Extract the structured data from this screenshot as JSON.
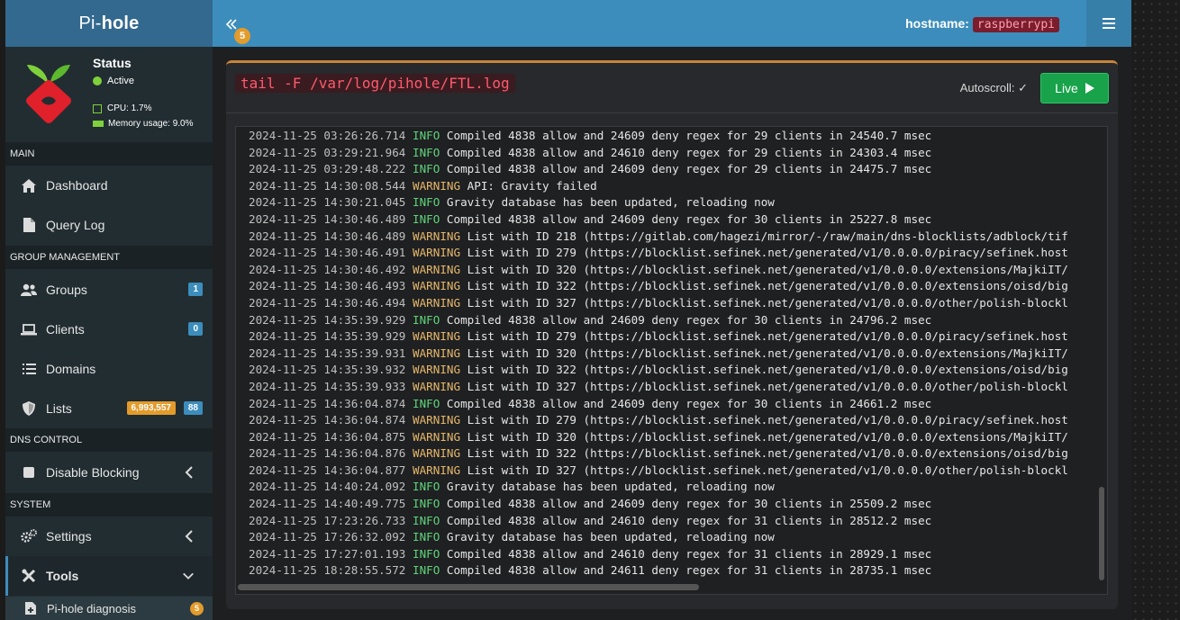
{
  "header": {
    "logo_light": "Pi-",
    "logo_bold": "hole",
    "collapse_badge": "5",
    "hostname_label": "hostname:",
    "hostname_value": "raspberrypi"
  },
  "sidebar": {
    "status_title": "Status",
    "status_text": "Active",
    "cpu_text": "CPU: 1.7%",
    "memory_text": "Memory usage: 9.0%",
    "sections": {
      "main": "MAIN",
      "group_management": "GROUP MANAGEMENT",
      "dns_control": "DNS CONTROL",
      "system": "SYSTEM"
    },
    "items": {
      "dashboard": "Dashboard",
      "query_log": "Query Log",
      "groups": "Groups",
      "groups_badge": "1",
      "clients": "Clients",
      "clients_badge": "0",
      "domains": "Domains",
      "lists": "Lists",
      "lists_badge_domains": "6,993,557",
      "lists_badge_count": "88",
      "disable_blocking": "Disable Blocking",
      "settings": "Settings",
      "tools": "Tools",
      "pihole_diagnosis": "Pi-hole diagnosis",
      "pihole_diagnosis_badge": "5"
    }
  },
  "main": {
    "command": "tail -F /var/log/pihole/FTL.log",
    "autoscroll_label": "Autoscroll:",
    "autoscroll_check": "✓",
    "live_label": "Live",
    "colors": {
      "info": "#5fd47a",
      "warning": "#e5b76a",
      "accent": "#3c8dbc",
      "box_border": "#c7843a"
    },
    "log": [
      {
        "ts": "2024-11-25 03:26:26.714",
        "level": "INFO",
        "msg": "Compiled 4838 allow and 24609 deny regex for 29 clients in 24540.7 msec"
      },
      {
        "ts": "2024-11-25 03:29:21.964",
        "level": "INFO",
        "msg": "Compiled 4838 allow and 24610 deny regex for 29 clients in 24303.4 msec"
      },
      {
        "ts": "2024-11-25 03:29:48.222",
        "level": "INFO",
        "msg": "Compiled 4838 allow and 24609 deny regex for 29 clients in 24475.7 msec"
      },
      {
        "ts": "2024-11-25 14:30:08.544",
        "level": "WARNING",
        "msg": "API: Gravity failed"
      },
      {
        "ts": "2024-11-25 14:30:21.045",
        "level": "INFO",
        "msg": "Gravity database has been updated, reloading now"
      },
      {
        "ts": "2024-11-25 14:30:46.489",
        "level": "INFO",
        "msg": "Compiled 4838 allow and 24609 deny regex for 30 clients in 25227.8 msec"
      },
      {
        "ts": "2024-11-25 14:30:46.489",
        "level": "WARNING",
        "msg": "List with ID 218 (https://gitlab.com/hagezi/mirror/-/raw/main/dns-blocklists/adblock/tif"
      },
      {
        "ts": "2024-11-25 14:30:46.491",
        "level": "WARNING",
        "msg": "List with ID 279 (https://blocklist.sefinek.net/generated/v1/0.0.0.0/piracy/sefinek.host"
      },
      {
        "ts": "2024-11-25 14:30:46.492",
        "level": "WARNING",
        "msg": "List with ID 320 (https://blocklist.sefinek.net/generated/v1/0.0.0.0/extensions/MajkiIT/"
      },
      {
        "ts": "2024-11-25 14:30:46.493",
        "level": "WARNING",
        "msg": "List with ID 322 (https://blocklist.sefinek.net/generated/v1/0.0.0.0/extensions/oisd/big"
      },
      {
        "ts": "2024-11-25 14:30:46.494",
        "level": "WARNING",
        "msg": "List with ID 327 (https://blocklist.sefinek.net/generated/v1/0.0.0.0/other/polish-blockl"
      },
      {
        "ts": "2024-11-25 14:35:39.929",
        "level": "INFO",
        "msg": "Compiled 4838 allow and 24609 deny regex for 30 clients in 24796.2 msec"
      },
      {
        "ts": "2024-11-25 14:35:39.929",
        "level": "WARNING",
        "msg": "List with ID 279 (https://blocklist.sefinek.net/generated/v1/0.0.0.0/piracy/sefinek.host"
      },
      {
        "ts": "2024-11-25 14:35:39.931",
        "level": "WARNING",
        "msg": "List with ID 320 (https://blocklist.sefinek.net/generated/v1/0.0.0.0/extensions/MajkiIT/"
      },
      {
        "ts": "2024-11-25 14:35:39.932",
        "level": "WARNING",
        "msg": "List with ID 322 (https://blocklist.sefinek.net/generated/v1/0.0.0.0/extensions/oisd/big"
      },
      {
        "ts": "2024-11-25 14:35:39.933",
        "level": "WARNING",
        "msg": "List with ID 327 (https://blocklist.sefinek.net/generated/v1/0.0.0.0/other/polish-blockl"
      },
      {
        "ts": "2024-11-25 14:36:04.874",
        "level": "INFO",
        "msg": "Compiled 4838 allow and 24609 deny regex for 30 clients in 24661.2 msec"
      },
      {
        "ts": "2024-11-25 14:36:04.874",
        "level": "WARNING",
        "msg": "List with ID 279 (https://blocklist.sefinek.net/generated/v1/0.0.0.0/piracy/sefinek.host"
      },
      {
        "ts": "2024-11-25 14:36:04.875",
        "level": "WARNING",
        "msg": "List with ID 320 (https://blocklist.sefinek.net/generated/v1/0.0.0.0/extensions/MajkiIT/"
      },
      {
        "ts": "2024-11-25 14:36:04.876",
        "level": "WARNING",
        "msg": "List with ID 322 (https://blocklist.sefinek.net/generated/v1/0.0.0.0/extensions/oisd/big"
      },
      {
        "ts": "2024-11-25 14:36:04.877",
        "level": "WARNING",
        "msg": "List with ID 327 (https://blocklist.sefinek.net/generated/v1/0.0.0.0/other/polish-blockl"
      },
      {
        "ts": "2024-11-25 14:40:24.092",
        "level": "INFO",
        "msg": "Gravity database has been updated, reloading now"
      },
      {
        "ts": "2024-11-25 14:40:49.775",
        "level": "INFO",
        "msg": "Compiled 4838 allow and 24609 deny regex for 30 clients in 25509.2 msec"
      },
      {
        "ts": "2024-11-25 17:23:26.733",
        "level": "INFO",
        "msg": "Compiled 4838 allow and 24610 deny regex for 31 clients in 28512.2 msec"
      },
      {
        "ts": "2024-11-25 17:26:32.092",
        "level": "INFO",
        "msg": "Gravity database has been updated, reloading now"
      },
      {
        "ts": "2024-11-25 17:27:01.193",
        "level": "INFO",
        "msg": "Compiled 4838 allow and 24610 deny regex for 31 clients in 28929.1 msec"
      },
      {
        "ts": "2024-11-25 18:28:55.572",
        "level": "INFO",
        "msg": "Compiled 4838 allow and 24611 deny regex for 31 clients in 28735.1 msec"
      }
    ]
  }
}
